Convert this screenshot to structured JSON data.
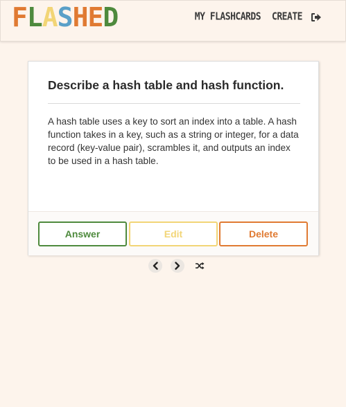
{
  "brand": {
    "letters": [
      {
        "char": "F",
        "color": "#e07a32"
      },
      {
        "char": "L",
        "color": "#4e8a3d"
      },
      {
        "char": "A",
        "color": "#f2d576"
      },
      {
        "char": "S",
        "color": "#5aa0c8"
      },
      {
        "char": "H",
        "color": "#e07a32"
      },
      {
        "char": "E",
        "color": "#e07a32"
      },
      {
        "char": "D",
        "color": "#4e8a3d"
      }
    ]
  },
  "nav": {
    "my_flashcards": "MY FLASHCARDS",
    "create": "CREATE",
    "logout_icon": "sign-out-icon"
  },
  "card": {
    "question": "Describe a hash table and hash function.",
    "answer_text": "A hash table uses a key to sort an index into a table. A hash function takes in a key, such as a string or integer, for a data record (key-value pair), scrambles it, and outputs an index to be used in a hash table."
  },
  "actions": {
    "answer": "Answer",
    "edit": "Edit",
    "delete": "Delete"
  },
  "controls": {
    "prev_icon": "chevron-left-icon",
    "next_icon": "chevron-right-icon",
    "shuffle_icon": "shuffle-icon"
  },
  "colors": {
    "background": "#fdf4ec",
    "green": "#4e8a3d",
    "yellow": "#f2d576",
    "orange": "#e07a32",
    "blue": "#5aa0c8"
  }
}
